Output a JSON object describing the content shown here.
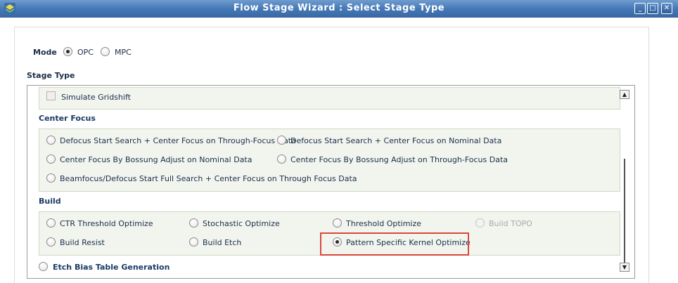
{
  "window": {
    "title": "Flow Stage Wizard : Select Stage Type",
    "minimize_symbol": "_",
    "maximize_symbol": "□",
    "close_symbol": "✕"
  },
  "mode": {
    "label": "Mode",
    "options": [
      {
        "label": "OPC",
        "selected": true
      },
      {
        "label": "MPC",
        "selected": false
      }
    ]
  },
  "stage_type_label": "Stage Type",
  "stage_list": {
    "top_item": {
      "label": "Simulate Gridshift",
      "checked": false
    },
    "center_focus": {
      "title": "Center Focus",
      "options": [
        {
          "label": "Defocus Start Search + Center Focus on Through-Focus Data",
          "selected": false
        },
        {
          "label": "Defocus Start Search + Center Focus on Nominal Data",
          "selected": false
        },
        {
          "label": "Center Focus By Bossung Adjust on Nominal Data",
          "selected": false
        },
        {
          "label": "Center Focus By Bossung Adjust on Through-Focus Data",
          "selected": false
        },
        {
          "label": "Beamfocus/Defocus Start Full Search + Center Focus on Through Focus Data",
          "selected": false
        }
      ]
    },
    "build": {
      "title": "Build",
      "options": [
        {
          "label": "CTR Threshold Optimize",
          "selected": false,
          "disabled": false
        },
        {
          "label": "Stochastic Optimize",
          "selected": false,
          "disabled": false
        },
        {
          "label": "Threshold Optimize",
          "selected": false,
          "disabled": false
        },
        {
          "label": "Build TOPO",
          "selected": false,
          "disabled": true
        },
        {
          "label": "Build Resist",
          "selected": false,
          "disabled": false
        },
        {
          "label": "Build Etch",
          "selected": false,
          "disabled": false
        },
        {
          "label": "Pattern Specific Kernel Optimize",
          "selected": true,
          "disabled": false
        }
      ]
    },
    "etch_bias": {
      "label": "Etch Bias Table Generation",
      "selected": false
    }
  },
  "colors": {
    "title_bar": "#4477b5",
    "highlight_border": "#d9473b",
    "group_background": "#f2f5ee",
    "label_text": "#1a2f4a"
  },
  "icons": {
    "app": "app-icon",
    "scroll_up": "arrow-up-icon",
    "scroll_down": "arrow-down-icon"
  }
}
